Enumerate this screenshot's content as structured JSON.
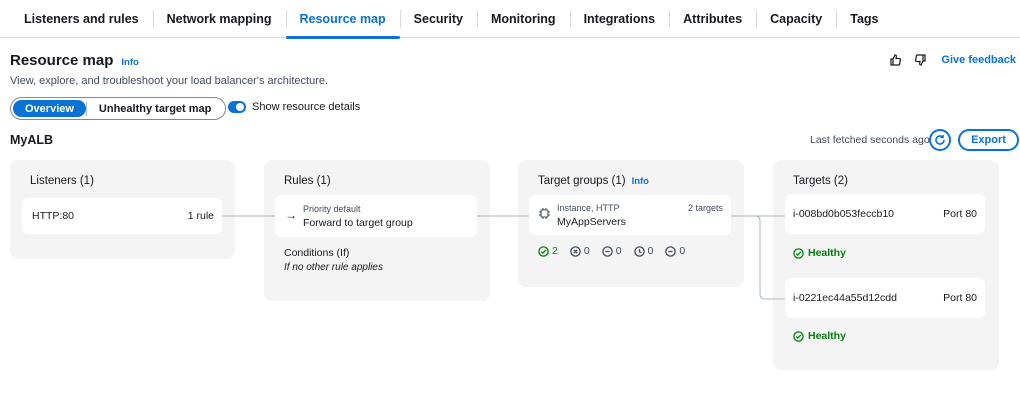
{
  "tabs": [
    {
      "label": "Listeners and rules"
    },
    {
      "label": "Network mapping"
    },
    {
      "label": "Resource map"
    },
    {
      "label": "Security"
    },
    {
      "label": "Monitoring"
    },
    {
      "label": "Integrations"
    },
    {
      "label": "Attributes"
    },
    {
      "label": "Capacity"
    },
    {
      "label": "Tags"
    }
  ],
  "active_tab": "Resource map",
  "header": {
    "title": "Resource map",
    "info": "Info",
    "subtitle": "View, explore, and troubleshoot your load balancer's architecture.",
    "feedback": "Give feedback"
  },
  "view": {
    "overview": "Overview",
    "unhealthy": "Unhealthy target map",
    "toggle_label": "Show resource details",
    "toggle_on": true
  },
  "load_balancer": {
    "name": "MyALB",
    "last_fetched": "Last fetched seconds ago",
    "export": "Export"
  },
  "listeners": {
    "title": "Listeners (1)",
    "items": [
      {
        "name": "HTTP:80",
        "rules": "1 rule"
      }
    ]
  },
  "rules": {
    "title": "Rules (1)",
    "items": [
      {
        "priority": "Priority default",
        "action": "Forward to target group"
      }
    ],
    "conditions_label": "Conditions (If)",
    "conditions_value": "If no other rule applies"
  },
  "target_groups": {
    "title": "Target groups (1)",
    "info": "Info",
    "items": [
      {
        "type": "Instance, HTTP",
        "name": "MyAppServers",
        "targets": "2 targets",
        "status_counts": {
          "healthy": "2",
          "unhealthy": "0",
          "unused": "0",
          "initial": "0",
          "draining": "0"
        }
      }
    ]
  },
  "targets": {
    "title": "Targets (2)",
    "items": [
      {
        "id": "i-008bd0b053feccb10",
        "port": "Port 80",
        "status": "Healthy"
      },
      {
        "id": "i-0221ec44a55d12cdd",
        "port": "Port 80",
        "status": "Healthy"
      }
    ]
  },
  "colors": {
    "accent": "#0972d3",
    "healthy": "#037f0c",
    "panel": "#f4f4f4"
  }
}
